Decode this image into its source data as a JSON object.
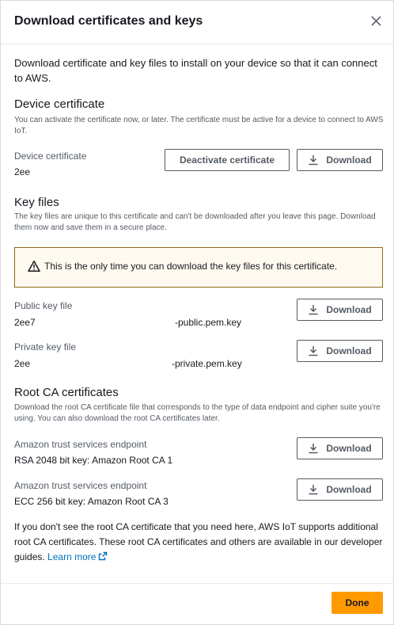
{
  "modal": {
    "title": "Download certificates and keys",
    "close_icon": "close-icon"
  },
  "intro": "Download certificate and key files to install on your device so that it can connect to AWS.",
  "device_certificate": {
    "heading": "Device certificate",
    "description": "You can activate the certificate now, or later. The certificate must be active for a device to connect to AWS IoT.",
    "label": "Device certificate",
    "value": "2ee",
    "deactivate_label": "Deactivate certificate",
    "download_label": "Download"
  },
  "key_files": {
    "heading": "Key files",
    "description": "The key files are unique to this certificate and can't be downloaded after you leave this page. Download them now and save them in a secure place.",
    "alert_text": "This is the only time you can download the key files for this certificate.",
    "alert_icon": "warning-icon",
    "public": {
      "label": "Public key file",
      "value_prefix": "2ee7",
      "value_suffix": "-public.pem.key",
      "download_label": "Download"
    },
    "private": {
      "label": "Private key file",
      "value_prefix": "2ee",
      "value_suffix": "-private.pem.key",
      "download_label": "Download"
    }
  },
  "root_ca": {
    "heading": "Root CA certificates",
    "description": "Download the root CA certificate file that corresponds to the type of data endpoint and cipher suite you're using. You can also download the root CA certificates later.",
    "items": [
      {
        "label": "Amazon trust services endpoint",
        "value": "RSA 2048 bit key: Amazon Root CA 1",
        "download_label": "Download"
      },
      {
        "label": "Amazon trust services endpoint",
        "value": "ECC 256 bit key: Amazon Root CA 3",
        "download_label": "Download"
      }
    ],
    "note": "If you don't see the root CA certificate that you need here, AWS IoT supports additional root CA certificates. These root CA certificates and others are available in our developer guides.",
    "learn_more": "Learn more"
  },
  "footer": {
    "done_label": "Done"
  },
  "colors": {
    "primary_button": "#ff9900",
    "link": "#0073bb",
    "alert_border": "#8c6b16",
    "alert_bg": "#fffaf0"
  }
}
